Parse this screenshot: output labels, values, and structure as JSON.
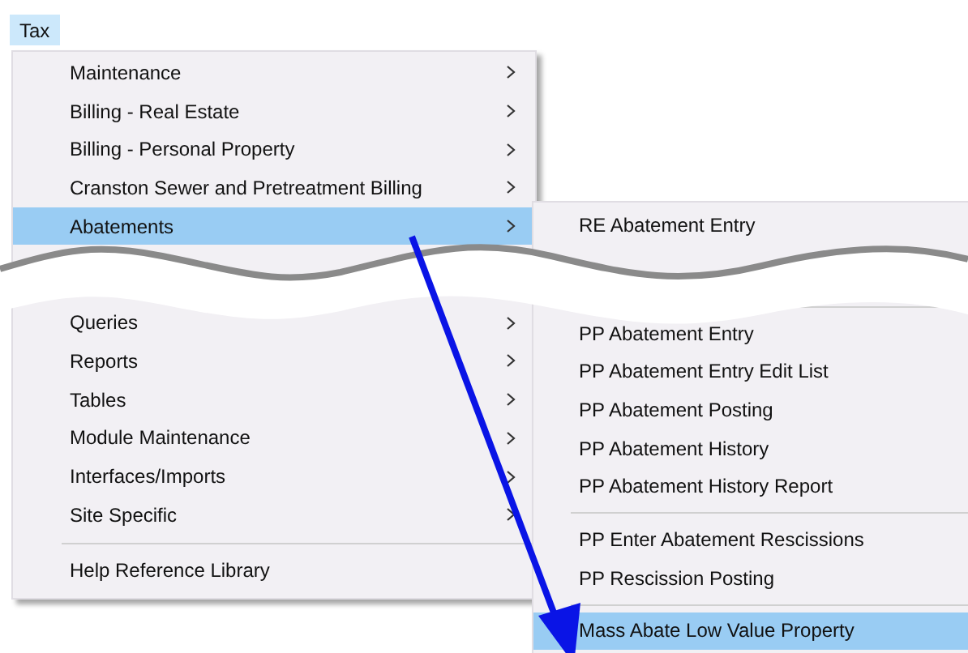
{
  "menu_bar": [
    {
      "label": "Tax",
      "selected": true
    }
  ],
  "menu": {
    "items": [
      {
        "kind": "item",
        "label": "Maintenance",
        "submenu": true,
        "selected": false
      },
      {
        "kind": "item",
        "label": "Billing - Real Estate",
        "submenu": true,
        "selected": false
      },
      {
        "kind": "item",
        "label": "Billing - Personal Property",
        "submenu": true,
        "selected": false
      },
      {
        "kind": "item",
        "label": "Cranston Sewer and Pretreatment Billing",
        "submenu": true,
        "selected": false
      },
      {
        "kind": "item",
        "label": "Abatements",
        "submenu": true,
        "selected": true
      },
      {
        "kind": "break"
      },
      {
        "kind": "item",
        "label": "Queries",
        "submenu": true,
        "selected": false
      },
      {
        "kind": "item",
        "label": "Reports",
        "submenu": true,
        "selected": false
      },
      {
        "kind": "item",
        "label": "Tables",
        "submenu": true,
        "selected": false
      },
      {
        "kind": "item",
        "label": "Module Maintenance",
        "submenu": true,
        "selected": false
      },
      {
        "kind": "item",
        "label": "Interfaces/Imports",
        "submenu": true,
        "selected": false
      },
      {
        "kind": "item",
        "label": "Site Specific",
        "submenu": true,
        "selected": false
      },
      {
        "kind": "separator"
      },
      {
        "kind": "item",
        "label": "Help Reference Library",
        "submenu": false,
        "selected": false
      }
    ]
  },
  "submenu": {
    "items": [
      {
        "kind": "item",
        "label": "RE Abatement Entry",
        "selected": false
      },
      {
        "kind": "break"
      },
      {
        "kind": "separator"
      },
      {
        "kind": "item",
        "label": "PP Abatement Entry",
        "selected": false
      },
      {
        "kind": "item",
        "label": "PP Abatement Entry Edit List",
        "selected": false
      },
      {
        "kind": "item",
        "label": "PP Abatement Posting",
        "selected": false
      },
      {
        "kind": "item",
        "label": "PP Abatement History",
        "selected": false
      },
      {
        "kind": "item",
        "label": "PP Abatement History Report",
        "selected": false
      },
      {
        "kind": "separator"
      },
      {
        "kind": "item",
        "label": "PP Enter Abatement Rescissions",
        "selected": false
      },
      {
        "kind": "item",
        "label": "PP Rescission Posting",
        "selected": false
      },
      {
        "kind": "separator"
      },
      {
        "kind": "item",
        "label": "Mass Abate Low Value Property",
        "selected": true
      }
    ]
  }
}
